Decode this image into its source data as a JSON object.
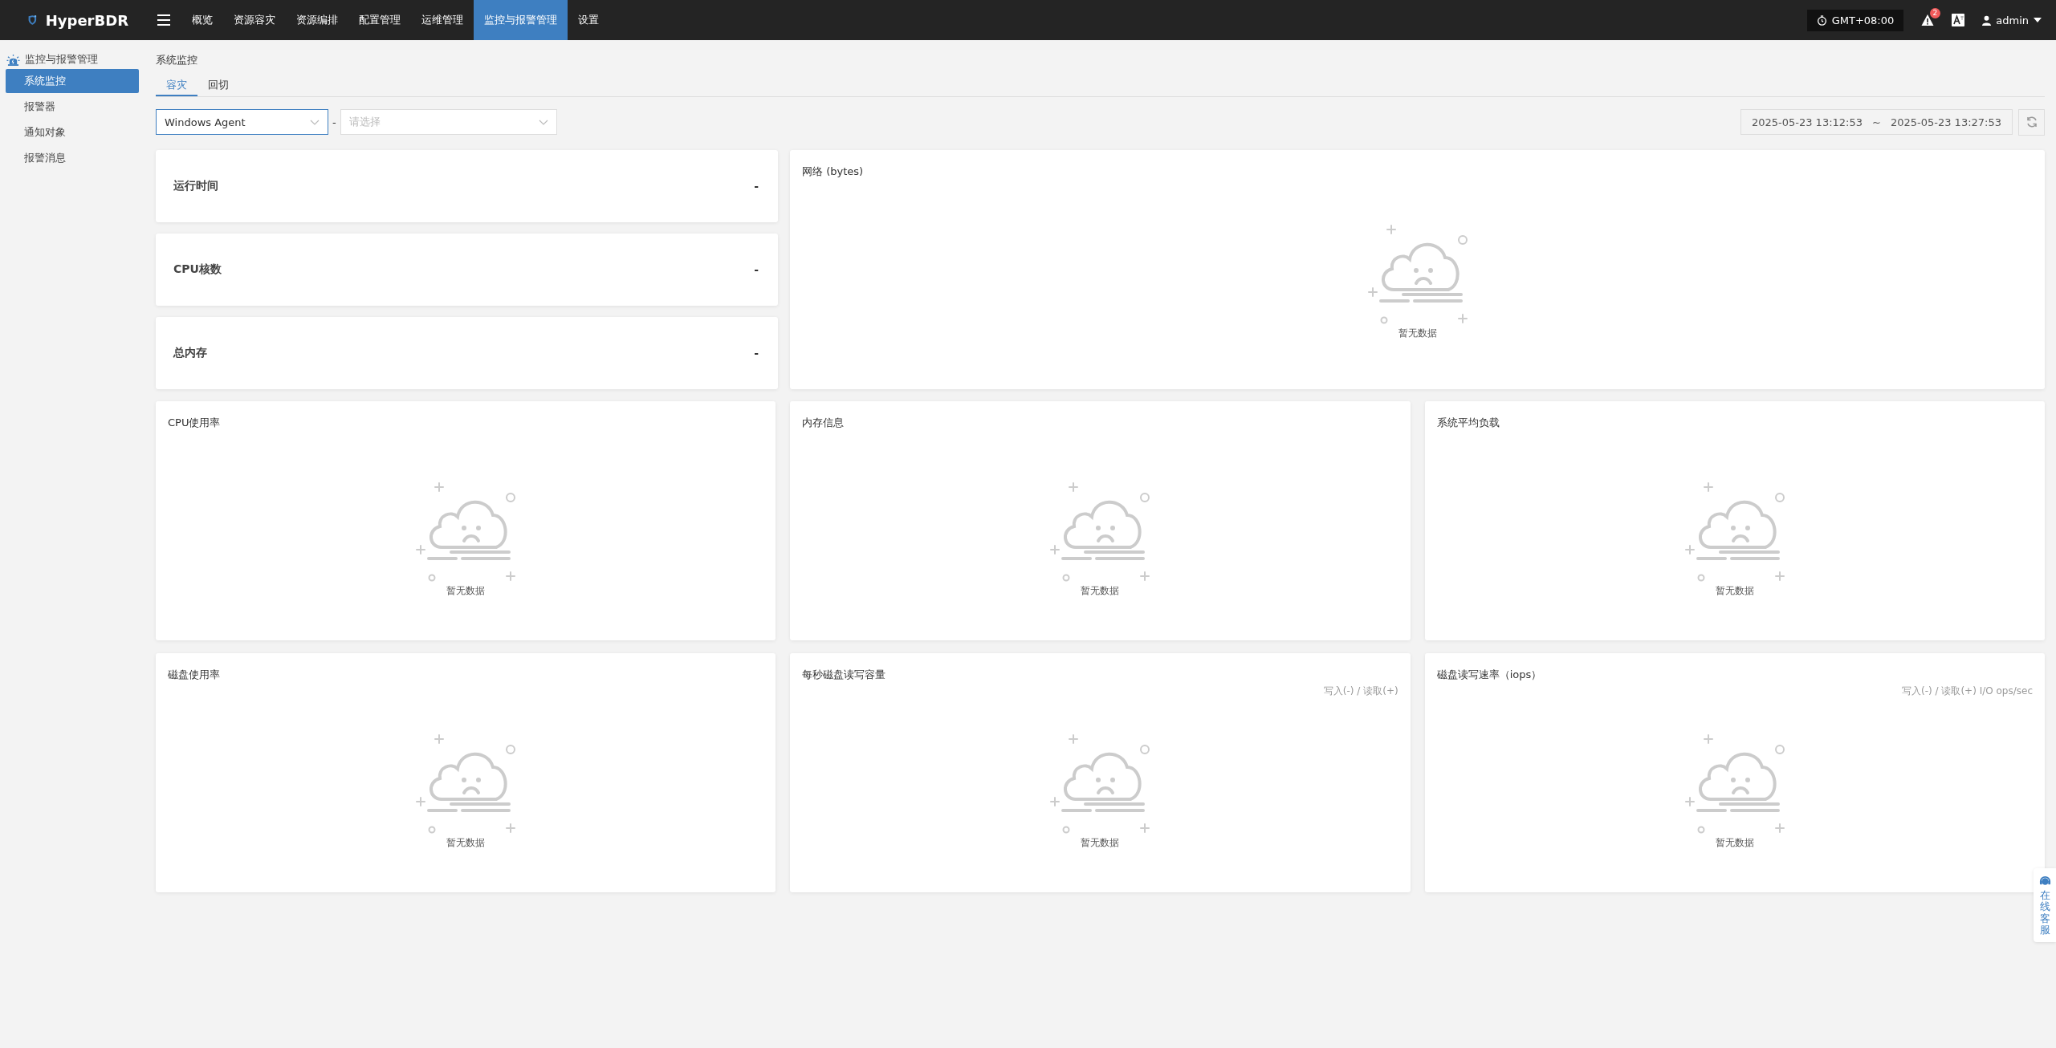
{
  "app": {
    "name": "HyperBDR"
  },
  "nav": [
    {
      "label": "概览",
      "selected": false
    },
    {
      "label": "资源容灾",
      "selected": false
    },
    {
      "label": "资源编排",
      "selected": false
    },
    {
      "label": "配置管理",
      "selected": false
    },
    {
      "label": "运维管理",
      "selected": false
    },
    {
      "label": "监控与报警管理",
      "selected": true
    },
    {
      "label": "设置",
      "selected": false
    }
  ],
  "topbar": {
    "timezone": "GMT+08:00",
    "alert_count": "2",
    "user": "admin"
  },
  "sidebar": {
    "title": "监控与报警管理",
    "items": [
      {
        "label": "系统监控",
        "selected": true
      },
      {
        "label": "报警器",
        "selected": false
      },
      {
        "label": "通知对象",
        "selected": false
      },
      {
        "label": "报警消息",
        "selected": false
      }
    ]
  },
  "page_title": "系统监控",
  "tabs": [
    {
      "label": "容灾",
      "selected": true
    },
    {
      "label": "回切",
      "selected": false
    }
  ],
  "filters": {
    "agent_type": "Windows Agent",
    "separator": "-",
    "host": {
      "placeholder": "请选择"
    }
  },
  "time_range": {
    "start": "2025-05-23 13:12:53",
    "separator": "~",
    "end": "2025-05-23 13:27:53"
  },
  "stats": [
    {
      "label": "运行时间",
      "value": "-"
    },
    {
      "label": "CPU核数",
      "value": "-"
    },
    {
      "label": "总内存",
      "value": "-"
    }
  ],
  "charts": [
    {
      "title": "网络 (bytes)",
      "empty_text": "暂无数据"
    },
    {
      "title": "CPU使用率",
      "empty_text": "暂无数据"
    },
    {
      "title": "内存信息",
      "empty_text": "暂无数据"
    },
    {
      "title": "系统平均负载",
      "empty_text": "暂无数据"
    },
    {
      "title": "磁盘使用率",
      "empty_text": "暂无数据"
    },
    {
      "title": "每秒磁盘读写容量",
      "legend": "写入(-) / 读取(+)",
      "empty_text": "暂无数据"
    },
    {
      "title": "磁盘读写速率（iops）",
      "legend": "写入(-) / 读取(+) I/O ops/sec",
      "empty_text": "暂无数据"
    }
  ],
  "support": {
    "label": "在线客服"
  }
}
